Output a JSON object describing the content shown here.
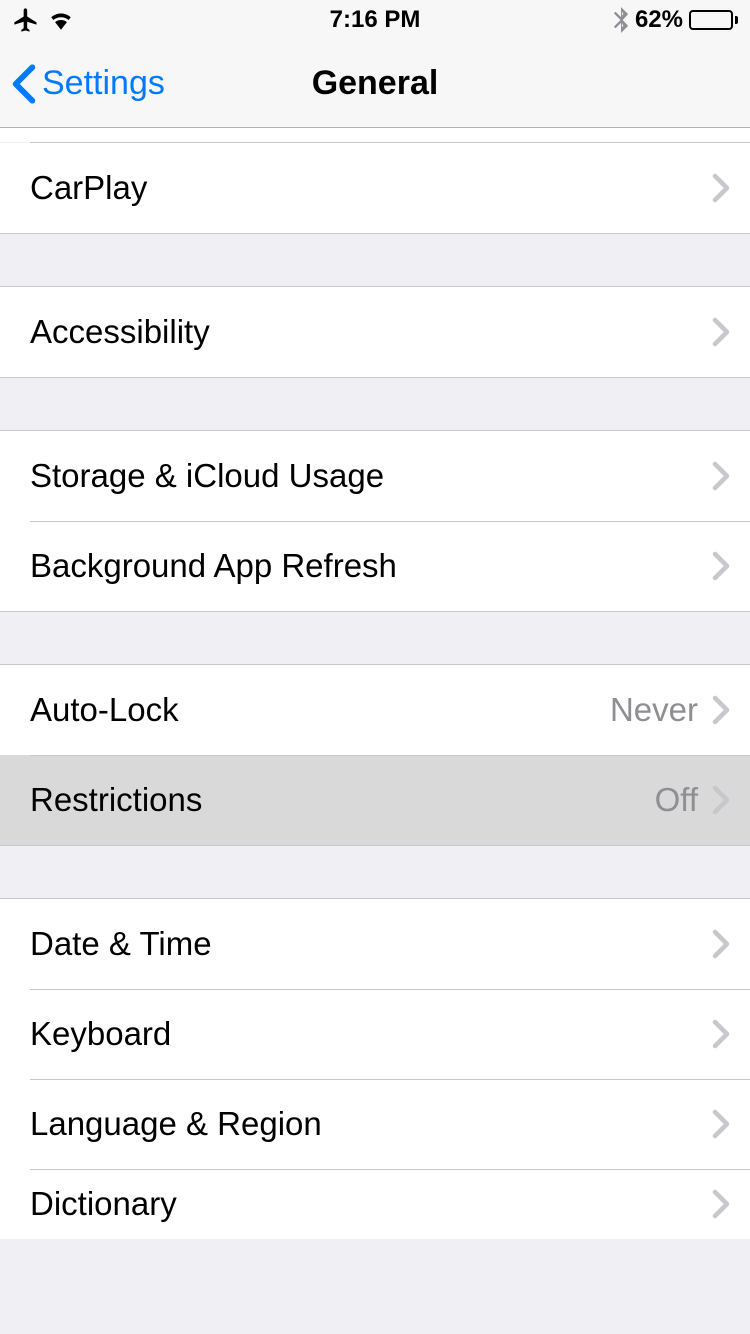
{
  "status_bar": {
    "time": "7:16 PM",
    "battery_percent": "62%"
  },
  "nav": {
    "back_label": "Settings",
    "title": "General"
  },
  "groups": [
    {
      "cells": [
        {
          "label": "CarPlay",
          "value": ""
        }
      ]
    },
    {
      "cells": [
        {
          "label": "Accessibility",
          "value": ""
        }
      ]
    },
    {
      "cells": [
        {
          "label": "Storage & iCloud Usage",
          "value": ""
        },
        {
          "label": "Background App Refresh",
          "value": ""
        }
      ]
    },
    {
      "cells": [
        {
          "label": "Auto-Lock",
          "value": "Never"
        },
        {
          "label": "Restrictions",
          "value": "Off",
          "pressed": true
        }
      ]
    },
    {
      "cells": [
        {
          "label": "Date & Time",
          "value": ""
        },
        {
          "label": "Keyboard",
          "value": ""
        },
        {
          "label": "Language & Region",
          "value": ""
        },
        {
          "label": "Dictionary",
          "value": ""
        }
      ]
    }
  ]
}
